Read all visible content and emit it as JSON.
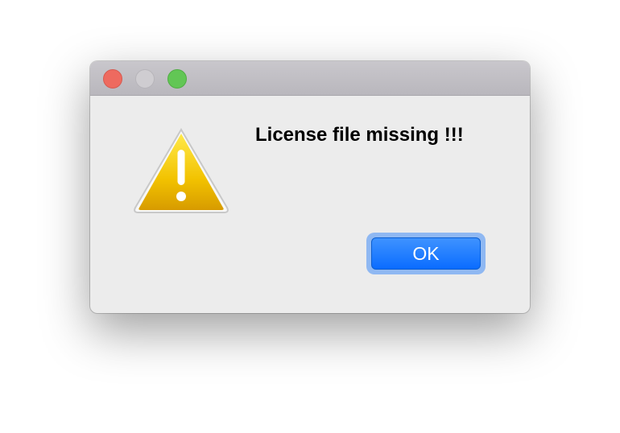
{
  "window": {
    "controls": {
      "close_icon": "close-traffic-light-icon",
      "minimize_icon": "minimize-traffic-light-icon",
      "zoom_icon": "zoom-traffic-light-icon"
    }
  },
  "dialog": {
    "icon": "warning-icon",
    "message": "License file missing !!!",
    "ok_label": "OK"
  },
  "colors": {
    "close": "#ee6a5f",
    "minimize": "#cfcdd1",
    "zoom": "#62c655",
    "warning": "#f2c200",
    "accent": "#0a6cff"
  }
}
